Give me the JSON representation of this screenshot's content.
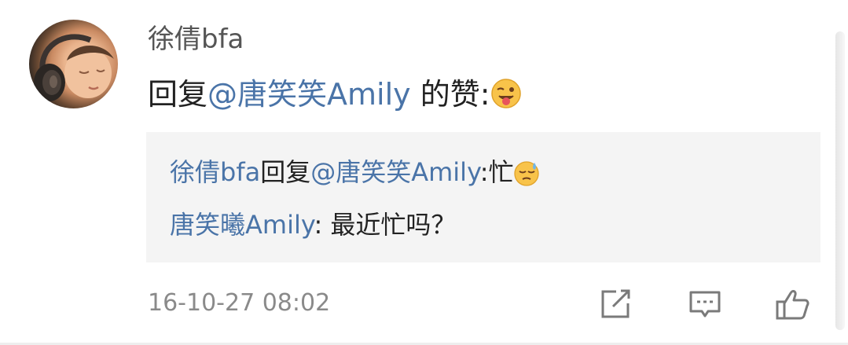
{
  "comment": {
    "author": "徐倩bfa",
    "reply_prefix": "回复",
    "reply_mention": "@唐笑笑Amily",
    "reply_suffix": " 的赞:",
    "reply_emoji": "wink-tongue-emoji",
    "timestamp": "16-10-27 08:02"
  },
  "quote": {
    "line1": {
      "author": "徐倩bfa",
      "reply_word": "回复",
      "mention": "@唐笑笑Amily",
      "text": ":忙",
      "emoji": "sweat-emoji"
    },
    "line2": {
      "author": "唐笑曦Amily",
      "text": ": 最近忙吗？"
    }
  },
  "actions": [
    {
      "name": "share",
      "icon": "share-edit-icon"
    },
    {
      "name": "comment",
      "icon": "comment-bubble-icon"
    },
    {
      "name": "like",
      "icon": "thumbs-up-icon"
    }
  ],
  "colors": {
    "mention": "#4a74a8",
    "username": "#555555",
    "text": "#222222",
    "timestamp": "#8a8a8a",
    "quote_bg": "#f4f4f4",
    "icon": "#7a7a7a"
  }
}
